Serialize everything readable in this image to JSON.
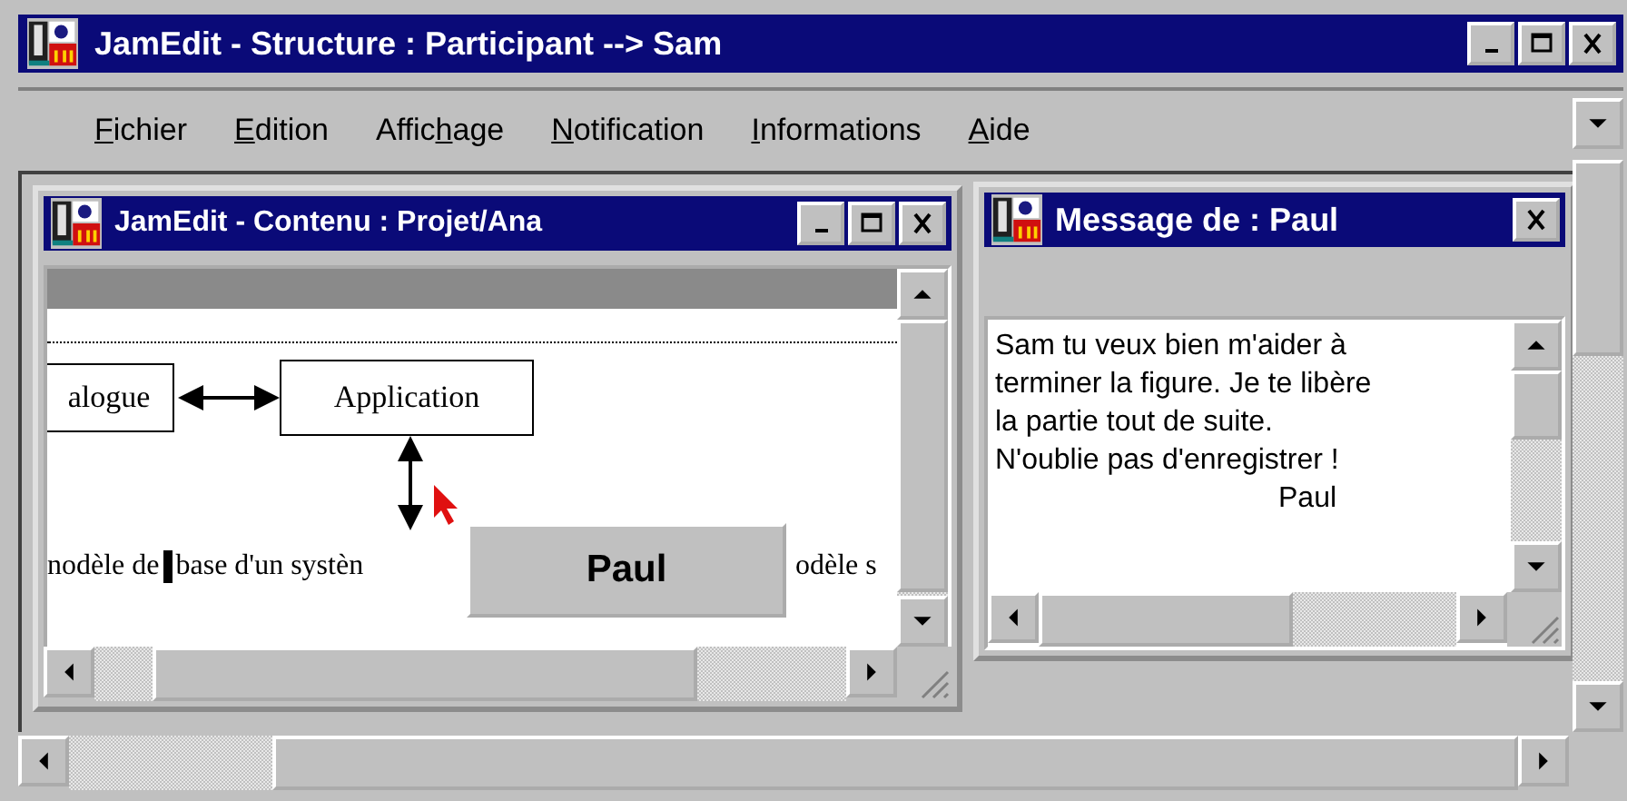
{
  "window": {
    "title": "JamEdit - Structure : Participant --> Sam"
  },
  "menu": [
    {
      "key": "F",
      "post": "ichier"
    },
    {
      "key": "E",
      "post": "dition"
    },
    {
      "pre": "Affic",
      "key": "h",
      "post": "age"
    },
    {
      "key": "N",
      "post": "otification"
    },
    {
      "key": "I",
      "post": "nformations"
    },
    {
      "key": "A",
      "post": "ide"
    }
  ],
  "content_window": {
    "title": "JamEdit - Contenu : Projet/Ana",
    "boxes": [
      "alogue",
      "Application"
    ],
    "text_parts": [
      "nodèle de",
      "base d'un systèn",
      "odèle s"
    ]
  },
  "popup": {
    "label": "Paul"
  },
  "message_window": {
    "title": "Message de : Paul",
    "lines": [
      "Sam tu veux bien m'aider à",
      "terminer la figure. Je te libère",
      "la partie tout de suite.",
      "N'oublie pas d'enregistrer !"
    ],
    "signature": "Paul"
  }
}
